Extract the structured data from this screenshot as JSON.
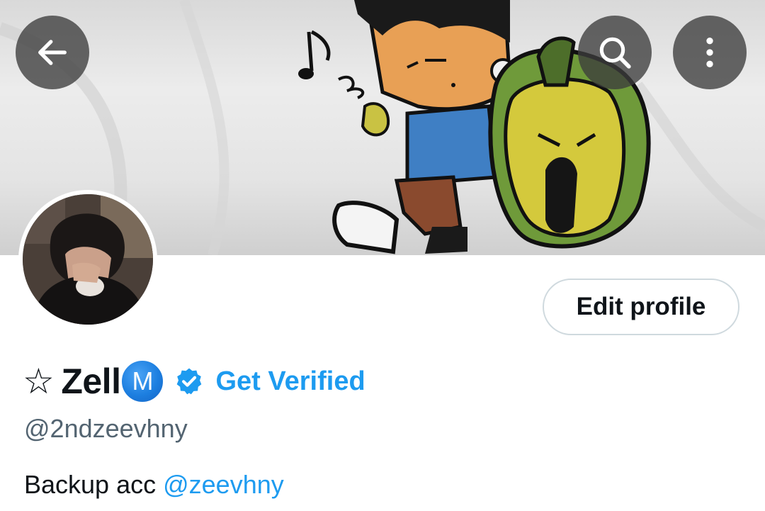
{
  "header": {
    "back_icon": "arrow-left-icon",
    "search_icon": "search-icon",
    "more_icon": "more-vertical-icon"
  },
  "profile": {
    "star_symbol": "☆",
    "display_name": "Zell",
    "badge_letter": "M",
    "verified_icon": "verified-badge-icon",
    "get_verified_label": "Get Verified",
    "handle": "@2ndzeevhny",
    "bio_text": "Backup acc ",
    "bio_mention": "@zeevhny",
    "edit_profile_label": "Edit profile"
  },
  "colors": {
    "accent": "#1d9bf0",
    "text_primary": "#0f1419",
    "text_secondary": "#536471",
    "button_border": "#cfd9de"
  }
}
